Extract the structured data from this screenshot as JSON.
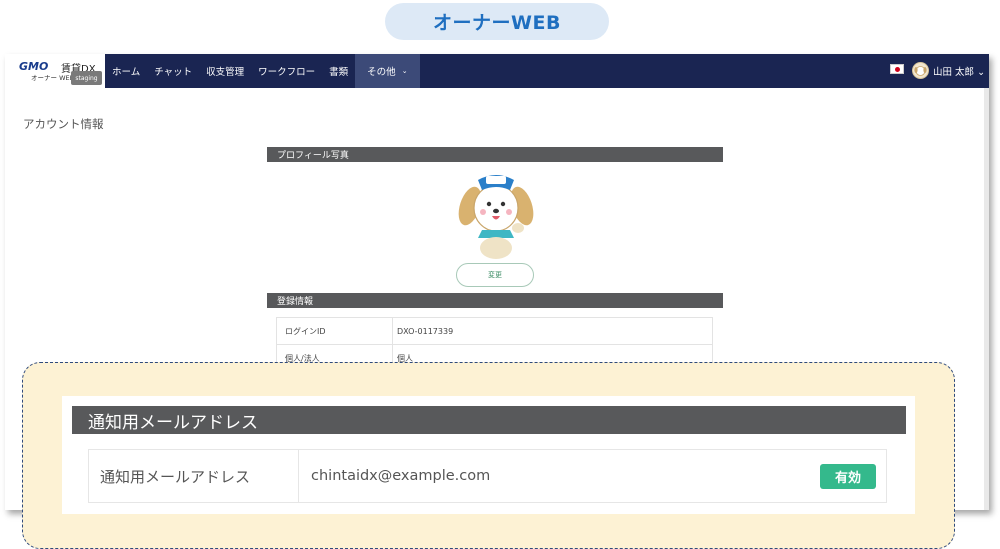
{
  "banner": {
    "title": "オーナーWEB"
  },
  "nav": {
    "logo": {
      "brand": "GMO",
      "product": "賃貸DX",
      "sub": "オーナー WEB",
      "env_badge": "staging"
    },
    "items": [
      {
        "label": "ホーム"
      },
      {
        "label": "チャット"
      },
      {
        "label": "収支管理"
      },
      {
        "label": "ワークフロー"
      },
      {
        "label": "書類"
      },
      {
        "label": "その他",
        "active": true,
        "has_dropdown": true
      }
    ],
    "language_flag": "japan-flag-icon",
    "user": {
      "name": "山田 太郎",
      "has_dropdown": true
    }
  },
  "page": {
    "title": "アカウント情報",
    "profile_section": {
      "heading": "プロフィール写真",
      "change_button": "変更",
      "avatar_icon": "dog-mascot-icon"
    },
    "registration_section": {
      "heading": "登録情報",
      "rows": [
        {
          "label": "ログインID",
          "value": "DXO-0117339"
        },
        {
          "label": "個人/法人",
          "value": "個人"
        }
      ]
    }
  },
  "highlight": {
    "heading": "通知用メールアドレス",
    "row": {
      "label": "通知用メールアドレス",
      "value": "chintaidx@example.com",
      "status": "有効"
    }
  },
  "colors": {
    "nav_bg": "#1a2552",
    "section_header_bg": "#58595b",
    "callout_bg": "#fdf2d4",
    "callout_border": "#2f4a7c",
    "badge_bg": "#34b98c",
    "banner_text": "#1f6fc0"
  }
}
